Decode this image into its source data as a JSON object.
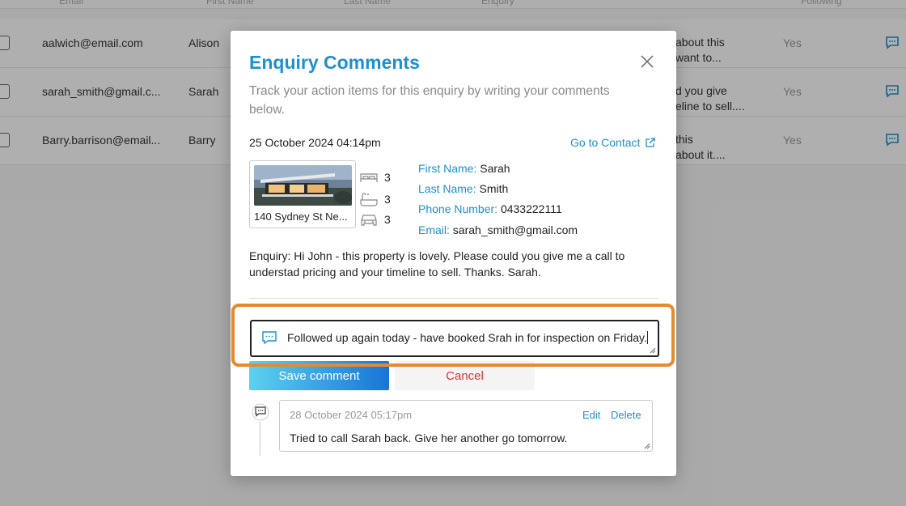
{
  "table": {
    "headers": [
      "Email",
      "First Name",
      "Last Name",
      "Enquiry",
      "Following"
    ],
    "rows": [
      {
        "email": "aalwich@email.com",
        "first_name": "Alison",
        "enquiry_l1": "about this",
        "enquiry_l2": "want to...",
        "following": "Yes"
      },
      {
        "email": "sarah_smith@gmail.c...",
        "first_name": "Sarah",
        "enquiry_l1": "d you give",
        "enquiry_l2": "eline to sell....",
        "following": "Yes"
      },
      {
        "email": "Barry.barrison@email...",
        "first_name": "Barry",
        "enquiry_l1": "this",
        "enquiry_l2": "about it....",
        "following": "Yes"
      }
    ]
  },
  "modal": {
    "title": "Enquiry Comments",
    "subtitle": "Track your action items for this enquiry by writing your comments below.",
    "date": "25 October 2024 04:14pm",
    "goto_contact": "Go to Contact",
    "property": {
      "address": "140 Sydney St Ne...",
      "bedrooms": "3",
      "bathrooms": "3",
      "parking": "3"
    },
    "contact": {
      "first_name_label": "First Name:",
      "first_name": "Sarah",
      "last_name_label": "Last Name:",
      "last_name": "Smith",
      "phone_label": "Phone Number:",
      "phone": "0433222111",
      "email_label": "Email:",
      "email": "sarah_smith@gmail.com"
    },
    "enquiry": "Enquiry: Hi John - this property is lovely. Please could you give me a call to understad pricing and your timeline to sell. Thanks. Sarah.",
    "comment_input_value": "Followed up again today - have booked Srah in for inspection on Friday.",
    "save_label": "Save comment",
    "cancel_label": "Cancel",
    "comments": [
      {
        "date": "28 October 2024 05:17pm",
        "edit_label": "Edit",
        "delete_label": "Delete",
        "text": "Tried to call Sarah back. Give her another go tomorrow."
      }
    ]
  },
  "colors": {
    "accent": "#1e8fd0",
    "cancel": "#d93535",
    "highlight": "#e8892f"
  }
}
